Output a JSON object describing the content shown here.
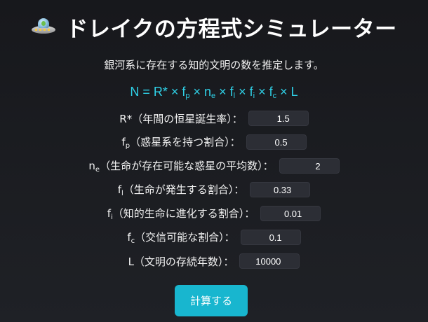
{
  "header": {
    "icon": "ufo-icon",
    "title": "ドレイクの方程式シミュレーター"
  },
  "description": "銀河系に存在する知的文明の数を推定します。",
  "equation": {
    "prefix": "N = R* × f",
    "fp_sub": "p",
    "mid1": " × n",
    "ne_sub": "e",
    "mid2": " × f",
    "fl_sub": "l",
    "mid3": " × f",
    "fi_sub": "i",
    "mid4": " × f",
    "fc_sub": "c",
    "suffix": " × L"
  },
  "params": {
    "rstar": {
      "label": "R*（年間の恒星誕生率）：",
      "value": "1.5"
    },
    "fp": {
      "label_base": "f",
      "label_sub": "p",
      "label_rest": "（惑星系を持つ割合）：",
      "value": "0.5"
    },
    "ne": {
      "label_base": "n",
      "label_sub": "e",
      "label_rest": "（生命が存在可能な惑星の平均数）：",
      "value": "2"
    },
    "fl": {
      "label_base": "f",
      "label_sub": "l",
      "label_rest": "（生命が発生する割合）：",
      "value": "0.33"
    },
    "fi": {
      "label_base": "f",
      "label_sub": "i",
      "label_rest": "（知的生命に進化する割合）：",
      "value": "0.01"
    },
    "fc": {
      "label_base": "f",
      "label_sub": "c",
      "label_rest": "（交信可能な割合）：",
      "value": "0.1"
    },
    "L": {
      "label": "L（文明の存続年数）：",
      "value": "10000"
    }
  },
  "button": {
    "calculate_label": "計算する"
  },
  "colors": {
    "background": "#1b1c21",
    "accent": "#18b6cf",
    "equation": "#2fd0e6",
    "input_bg": "#2c2e35"
  }
}
